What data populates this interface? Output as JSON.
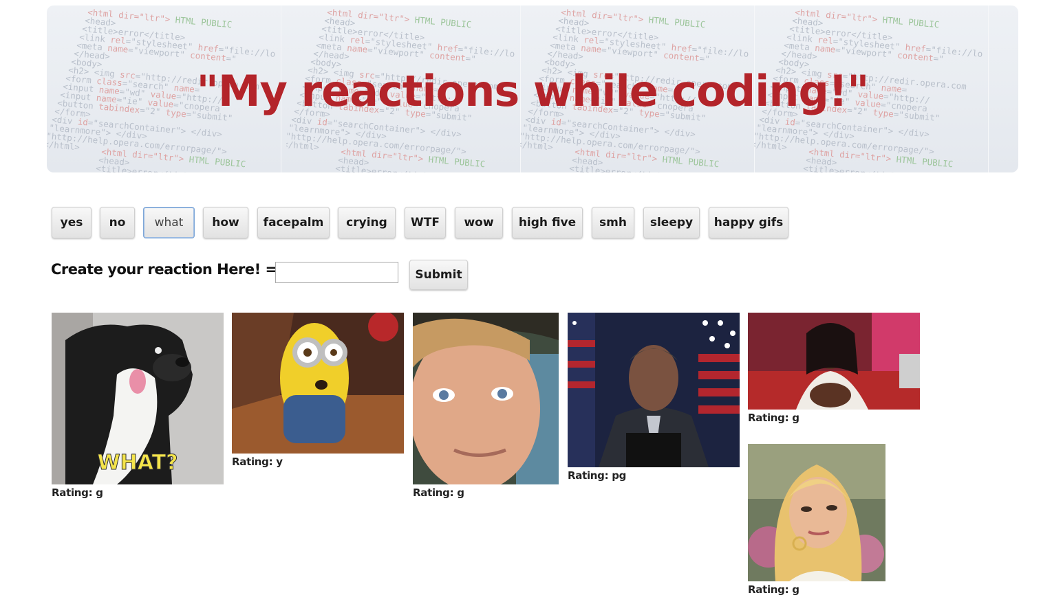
{
  "header": {
    "title": "\"My reactions while coding!\""
  },
  "buttons": [
    "yes",
    "no",
    "what",
    "how",
    "facepalm",
    "crying",
    "WTF",
    "wow",
    "high five",
    "smh",
    "sleepy",
    "happy gifs"
  ],
  "active_button": "what",
  "create": {
    "label": "Create your reaction Here! ===>",
    "input_value": "",
    "submit_label": "Submit"
  },
  "gifs": [
    {
      "rating_label": "Rating: g",
      "subject": "dog-what-gif",
      "caption": "WHAT?"
    },
    {
      "rating_label": "Rating: y",
      "subject": "minion-gif"
    },
    {
      "rating_label": "Rating: g",
      "subject": "man-closeup-gif"
    },
    {
      "rating_label": "Rating: pg",
      "subject": "speaker-podium-gif"
    },
    {
      "rating_label": "Rating: g",
      "subject": "woman-looking-away-gif"
    },
    {
      "rating_label": "Rating: g",
      "subject": "woman-side-eye-gif"
    }
  ],
  "colors": {
    "title": "#b3242a",
    "banner_bg": "#e9ecf1",
    "active_border": "#7ea7d8"
  }
}
